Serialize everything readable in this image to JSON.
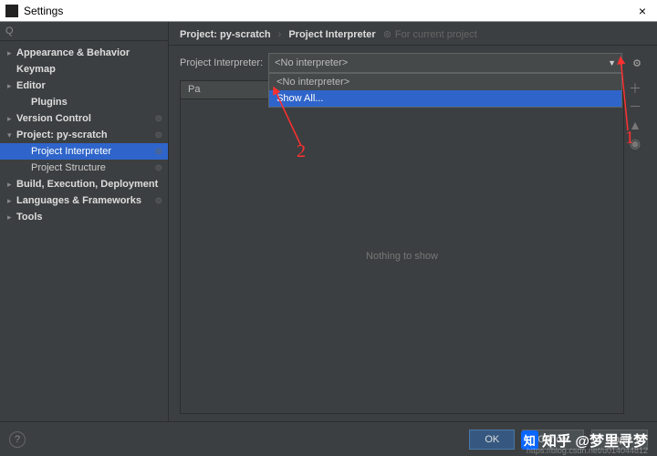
{
  "window": {
    "title": "Settings",
    "close": "×"
  },
  "search": {
    "placeholder": "",
    "value": "",
    "icon": "Q"
  },
  "sidebar": {
    "items": [
      {
        "label": "Appearance & Behavior",
        "arrow": "▸",
        "bold": true
      },
      {
        "label": "Keymap",
        "arrow": "",
        "bold": true
      },
      {
        "label": "Editor",
        "arrow": "▸",
        "bold": true
      },
      {
        "label": "Plugins",
        "arrow": "",
        "bold": true,
        "child": true
      },
      {
        "label": "Version Control",
        "arrow": "▸",
        "bold": true,
        "badge": "⊚"
      },
      {
        "label": "Project: py-scratch",
        "arrow": "▾",
        "bold": true,
        "badge": "⊚"
      },
      {
        "label": "Project Interpreter",
        "arrow": "",
        "child": true,
        "selected": true,
        "badge": "⊚"
      },
      {
        "label": "Project Structure",
        "arrow": "",
        "child": true,
        "badge": "⊚"
      },
      {
        "label": "Build, Execution, Deployment",
        "arrow": "▸",
        "bold": true
      },
      {
        "label": "Languages & Frameworks",
        "arrow": "▸",
        "bold": true,
        "badge": "⊚"
      },
      {
        "label": "Tools",
        "arrow": "▸",
        "bold": true
      }
    ]
  },
  "breadcrumb": {
    "a": "Project: py-scratch",
    "sep": "›",
    "b": "Project Interpreter",
    "note": "For current project"
  },
  "interpreter": {
    "label": "Project Interpreter:",
    "selected": "<No interpreter>",
    "options": [
      {
        "label": "<No interpreter>"
      },
      {
        "label": "Show All...",
        "hl": true
      }
    ]
  },
  "table": {
    "headers": [
      "Pa"
    ],
    "empty": "Nothing to show"
  },
  "buttons": {
    "ok": "OK",
    "cancel": "Cancel",
    "apply": "Apply",
    "help": "?"
  },
  "annotations": {
    "one": "1",
    "two": "2"
  },
  "watermark": {
    "logo": "知",
    "text": "知乎 @梦里寻梦",
    "url": "https://blog.csdn.net/u014044812"
  }
}
